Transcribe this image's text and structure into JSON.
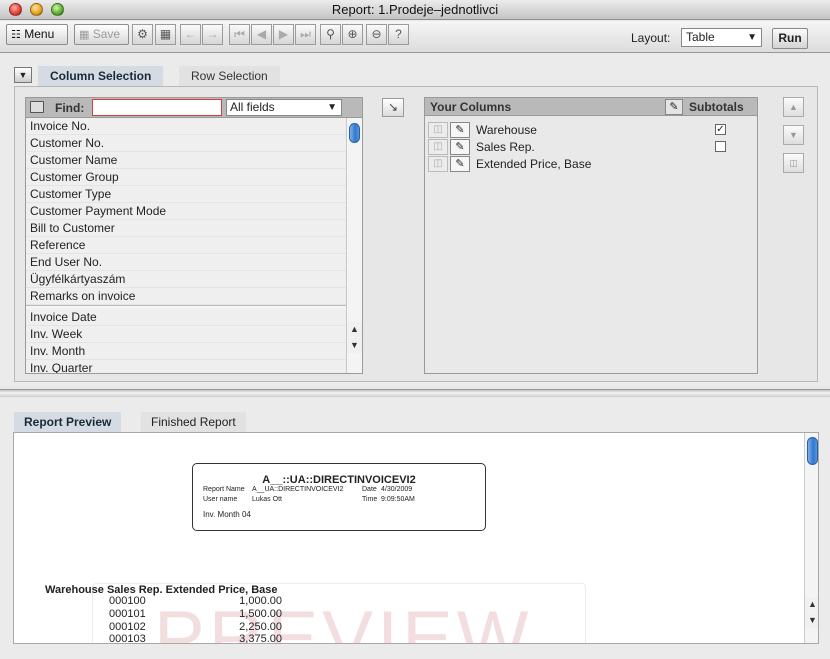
{
  "window": {
    "title": "Report: 1.Prodeje–jednotlivci"
  },
  "toolbar": {
    "menu_label": "Menu",
    "save_label": "Save",
    "layout_label": "Layout:",
    "layout_value": "Table",
    "run_label": "Run"
  },
  "tabs": {
    "column_selection": "Column Selection",
    "row_selection": "Row Selection"
  },
  "find": {
    "label": "Find:",
    "value": "",
    "fields_value": "All fields"
  },
  "fields": {
    "group1": [
      "Invoice No.",
      "Customer No.",
      "Customer Name",
      "Customer Group",
      "Customer Type",
      "Customer Payment Mode",
      "Bill to Customer",
      "Reference",
      "End User No.",
      "Ügyfélkártyaszám",
      "Remarks on invoice"
    ],
    "group2": [
      "Invoice Date",
      "Inv. Week",
      "Inv. Month",
      "Inv. Quarter"
    ]
  },
  "columns": {
    "title": "Your Columns",
    "subtotals_label": "Subtotals",
    "rows": [
      {
        "label": "Warehouse",
        "subtotal": true
      },
      {
        "label": "Sales Rep.",
        "subtotal": false
      },
      {
        "label": "Extended Price, Base"
      }
    ]
  },
  "bottom_tabs": {
    "preview": "Report Preview",
    "finished": "Finished Report"
  },
  "report": {
    "title": "A__::UA::DIRECTINVOICEVI2",
    "report_name_label": "Report Name",
    "report_name_value": "A__UA::DIRECTINVOICEVI2",
    "date_label": "Date",
    "date_value": "4/30/2009",
    "user_label": "User name",
    "user_value": "Lukas Ott",
    "time_label": "Time",
    "time_value": "9:09:50AM",
    "group_line": "Inv. Month  04",
    "col_headers": "Warehouse Sales Rep. Extended Price, Base",
    "rows": [
      {
        "warehouse": "000100",
        "value": "1,000.00"
      },
      {
        "warehouse": "000101",
        "value": "1,500.00"
      },
      {
        "warehouse": "000102",
        "value": "2,250.00"
      },
      {
        "warehouse": "000103",
        "value": "3,375.00"
      }
    ],
    "watermark": "PREVIEW"
  },
  "colors": {
    "tab_active_bg": "#d4dbe2",
    "scroll_thumb": "#2f77d0",
    "find_border": "#d04040"
  },
  "icons": [
    "menu-icon",
    "save-icon",
    "records-icon",
    "table-icon",
    "back-arrow-icon",
    "forward-arrow-icon",
    "first-icon",
    "prev-icon",
    "next-icon",
    "last-icon",
    "zoom-icon",
    "zoom-in-icon",
    "zoom-out-icon",
    "help-icon",
    "folder-icon",
    "add-column-icon",
    "pencil-icon",
    "trash-icon",
    "move-up-icon",
    "move-down-icon",
    "delete-icon"
  ]
}
